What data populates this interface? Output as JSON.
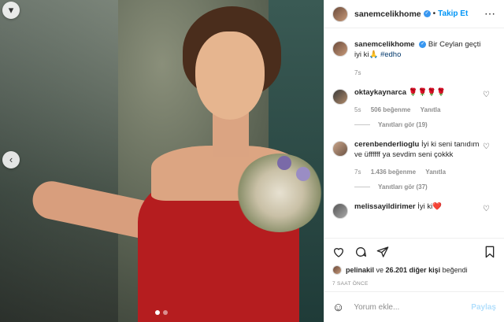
{
  "post": {
    "nav_prev_icon": "chevron-left-icon",
    "carousel_dots": 2,
    "carousel_active_index": 0
  },
  "header": {
    "username": "sanemcelikhome",
    "separator": "•",
    "follow_label": "Takip Et",
    "more_label": "⋯"
  },
  "caption": {
    "username": "sanemcelikhome",
    "text": "Bir Ceylan geçti iyi ki🙏",
    "hashtag": "#edho",
    "time": "7s"
  },
  "comments": [
    {
      "username": "oktaykaynarca",
      "text": "🌹🌹🌹🌹",
      "time": "5s",
      "likes": "506 beğenme",
      "reply_label": "Yanıtla",
      "replies": "Yanıtları gör (19)"
    },
    {
      "username": "cerenbenderlioglu",
      "text": "İyi ki seni tanıdım ve üffffff ya sevdim seni çokkk",
      "time": "7s",
      "likes": "1.436 beğenme",
      "reply_label": "Yanıtla",
      "replies": "Yanıtları gör (37)"
    },
    {
      "username": "melissayildirimer",
      "text": "İyi ki❤️"
    }
  ],
  "actions": {
    "liked_by_user": "pelinakil",
    "likes_text_mid": " ve ",
    "likes_count": "26.201 diğer kişi",
    "likes_text_end": " beğendi",
    "time_ago": "7 SAAT ÖNCE"
  },
  "comment_input": {
    "placeholder": "Yorum ekle...",
    "post_label": "Paylaş"
  },
  "colors": {
    "accent": "#0095f6",
    "verified": "#3897f0",
    "dress": "#b51d1f"
  }
}
